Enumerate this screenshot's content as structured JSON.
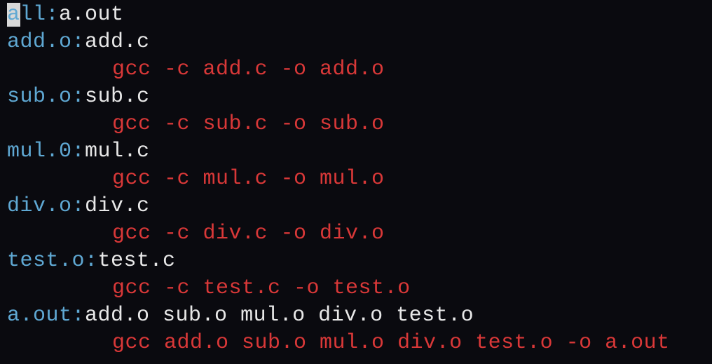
{
  "lines": {
    "l1_target": "all:",
    "l1_first_char": "a",
    "l1_rest": "ll:",
    "l1_dep": "a.out",
    "l2_target": "add.o:",
    "l2_dep": "add.c",
    "l3_cmd": "gcc -c add.c -o add.o",
    "l4_target": "sub.o:",
    "l4_dep": "sub.c",
    "l5_cmd": "gcc -c sub.c -o sub.o",
    "l6_target": "mul.0:",
    "l6_dep": "mul.c",
    "l7_cmd": "gcc -c mul.c -o mul.o",
    "l8_target": "div.o:",
    "l8_dep": "div.c",
    "l9_cmd": "gcc -c div.c -o div.o",
    "l10_target": "test.o:",
    "l10_dep": "test.c",
    "l11_cmd": "gcc -c test.c -o test.o",
    "l12_target": "a.out:",
    "l12_dep": "add.o sub.o mul.o div.o test.o",
    "l13_cmd": "gcc add.o sub.o mul.o div.o test.o -o a.out"
  }
}
